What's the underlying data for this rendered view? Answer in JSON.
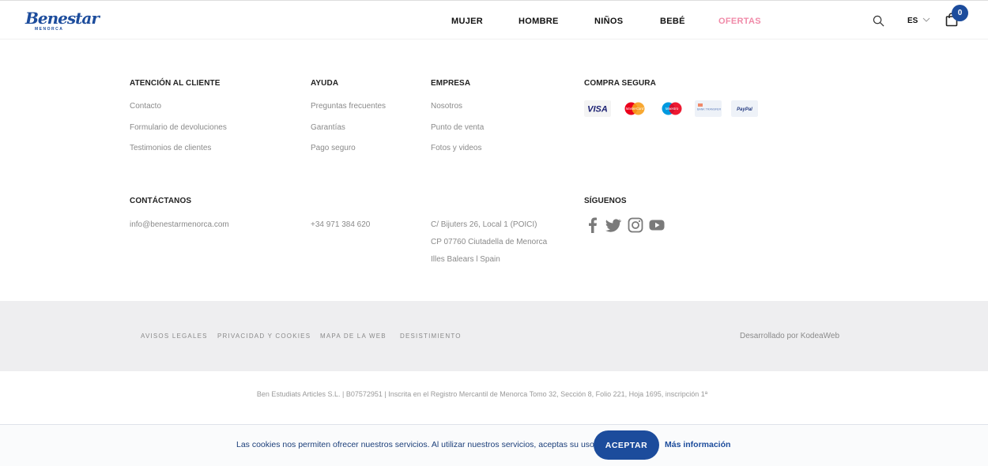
{
  "brand": {
    "logo_script": "Benestar",
    "logo_sub": "MENORCA"
  },
  "nav": {
    "items": [
      {
        "label": "MUJER"
      },
      {
        "label": "HOMBRE"
      },
      {
        "label": "NIÑOS"
      },
      {
        "label": "BEBÉ"
      },
      {
        "label": "OFERTAS"
      }
    ],
    "offers_color": "#f08aa8"
  },
  "header": {
    "language": "ES",
    "cart_count": "0"
  },
  "footer": {
    "customer_service": {
      "title": "ATENCIÓN AL CLIENTE",
      "links": [
        "Contacto",
        "Formulario de devoluciones",
        "Testimonios de clientes"
      ]
    },
    "help": {
      "title": "AYUDA",
      "links": [
        "Preguntas frecuentes",
        "Garantías",
        "Pago seguro"
      ]
    },
    "company": {
      "title": "EMPRESA",
      "links": [
        "Nosotros",
        "Punto de venta",
        "Fotos y videos"
      ]
    },
    "secure": {
      "title": "COMPRA SEGURA",
      "methods": [
        {
          "label": "VISA",
          "icon": "visa-icon"
        },
        {
          "label": "MasterCard",
          "icon": "mastercard-icon"
        },
        {
          "label": "Maestro",
          "icon": "maestro-icon"
        },
        {
          "label": "BANK TRANSFER",
          "icon": "bank-transfer-icon"
        },
        {
          "label": "PayPal",
          "icon": "paypal-icon"
        }
      ]
    },
    "contact": {
      "title": "CONTÁCTANOS",
      "email": "info@benestarmenorca.com",
      "phone": "+34 971 384 620",
      "address": "C/ Bijuters 26, Local 1 (POICI) CP 07760 Ciutadella de Menorca Illes Balears l Spain"
    },
    "follow": {
      "title": "SÍGUENOS",
      "networks": [
        "facebook-icon",
        "twitter-icon",
        "instagram-icon",
        "youtube-icon"
      ]
    }
  },
  "legal": {
    "links": [
      "AVISOS LEGALES",
      "PRIVACIDAD Y COOKIES",
      "MAPA DE LA WEB",
      "DESISTIMIENTO"
    ],
    "developer": "Desarrollado por KodeaWeb",
    "registry": "Ben Estudiats Articles S.L. | B07572951 | Inscrita en el Registro Mercantil de Menorca Tomo 32, Sección 8, Folio 221, Hoja 1695, inscripción 1ª"
  },
  "cookies": {
    "text": "Las cookies nos permiten ofrecer nuestros servicios. Al utilizar nuestros servicios, aceptas su uso.",
    "accept": "ACEPTAR",
    "more": "Más información"
  },
  "colors": {
    "brand_blue": "#1c4c9c",
    "legal_bg": "#eeeef0"
  }
}
